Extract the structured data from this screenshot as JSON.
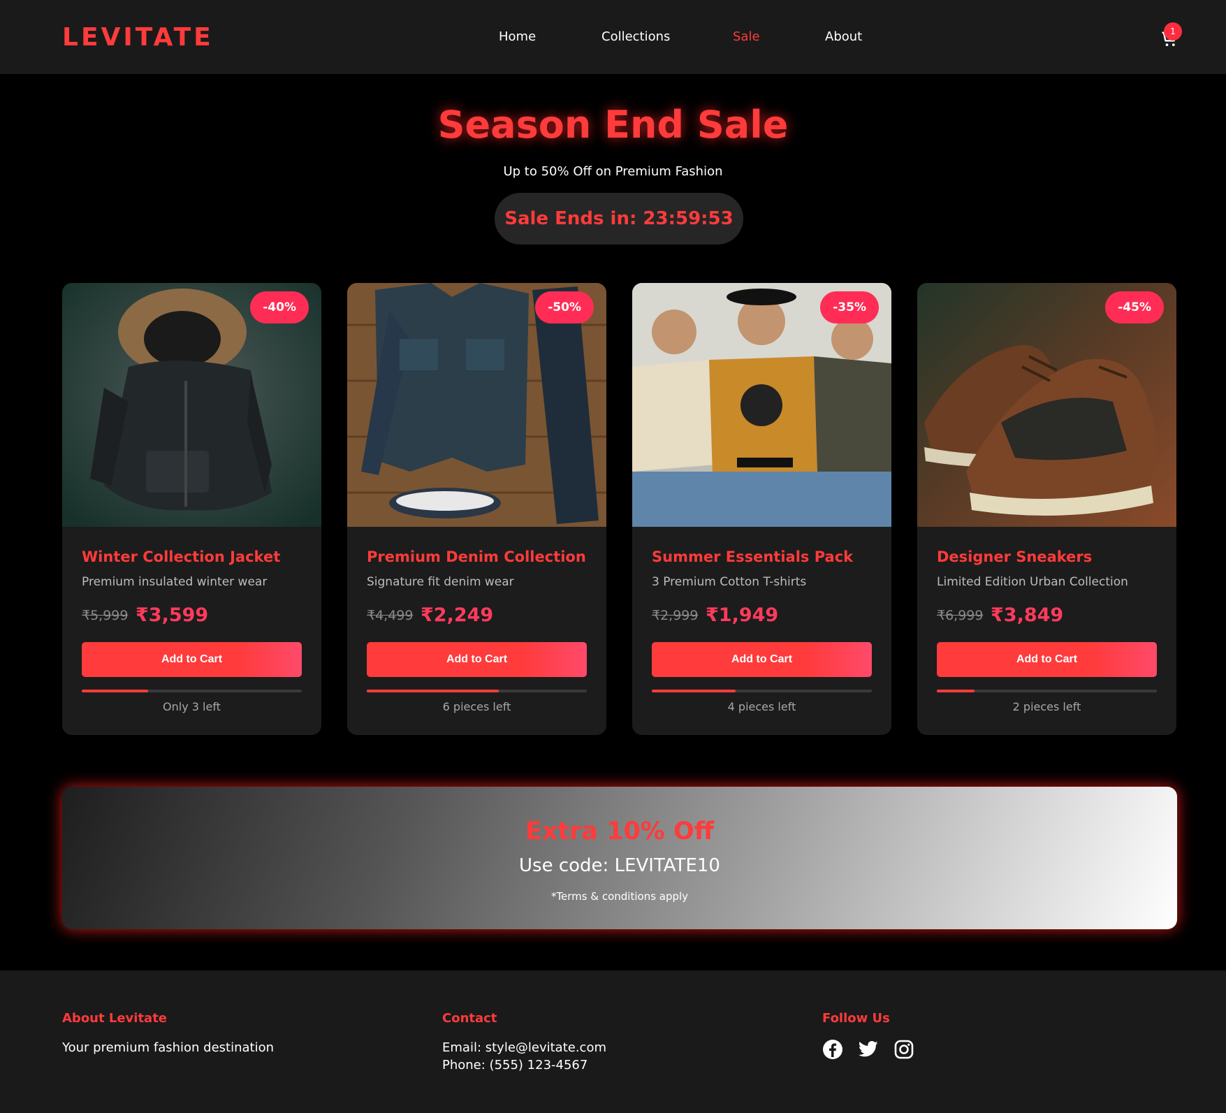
{
  "header": {
    "logo": "LEVITATE",
    "nav": [
      "Home",
      "Collections",
      "Sale",
      "About"
    ],
    "active_nav": "Sale",
    "cart_count": "1",
    "cart_icon": "cart-icon"
  },
  "hero": {
    "title": "Season End Sale",
    "subtitle": "Up to 50% Off on Premium Fashion",
    "timer": "Sale Ends in: 23:59:53"
  },
  "products": [
    {
      "discount": "-40%",
      "title": "Winter Collection Jacket",
      "desc": "Premium insulated winter wear",
      "old_price": "₹5,999",
      "new_price": "₹3,599",
      "button": "Add to Cart",
      "stock_level": 0.3,
      "stock_text": "Only 3 left"
    },
    {
      "discount": "-50%",
      "title": "Premium Denim Collection",
      "desc": "Signature fit denim wear",
      "old_price": "₹4,499",
      "new_price": "₹2,249",
      "button": "Add to Cart",
      "stock_level": 0.6,
      "stock_text": "6 pieces left"
    },
    {
      "discount": "-35%",
      "title": "Summer Essentials Pack",
      "desc": "3 Premium Cotton T-shirts",
      "old_price": "₹2,999",
      "new_price": "₹1,949",
      "button": "Add to Cart",
      "stock_level": 0.38,
      "stock_text": "4 pieces left"
    },
    {
      "discount": "-45%",
      "title": "Designer Sneakers",
      "desc": "Limited Edition Urban Collection",
      "old_price": "₹6,999",
      "new_price": "₹3,849",
      "button": "Add to Cart",
      "stock_level": 0.17,
      "stock_text": "2 pieces left"
    }
  ],
  "promo": {
    "title": "Extra 10% Off",
    "code_line": "Use code: LEVITATE10",
    "terms": "*Terms & conditions apply"
  },
  "footer": {
    "about_heading": "About Levitate",
    "about_text": "Your premium fashion destination",
    "contact_heading": "Contact",
    "email": "Email: style@levitate.com",
    "phone": "Phone: (555) 123-4567",
    "follow_heading": "Follow Us",
    "social_icons": [
      "facebook-icon",
      "twitter-icon",
      "instagram-icon"
    ]
  },
  "colors": {
    "accent": "#ff3b3b",
    "price": "#ff3b5c",
    "badge": "#ff2d55",
    "card_bg": "#1c1c1c",
    "header_bg": "#1a1a1a"
  }
}
